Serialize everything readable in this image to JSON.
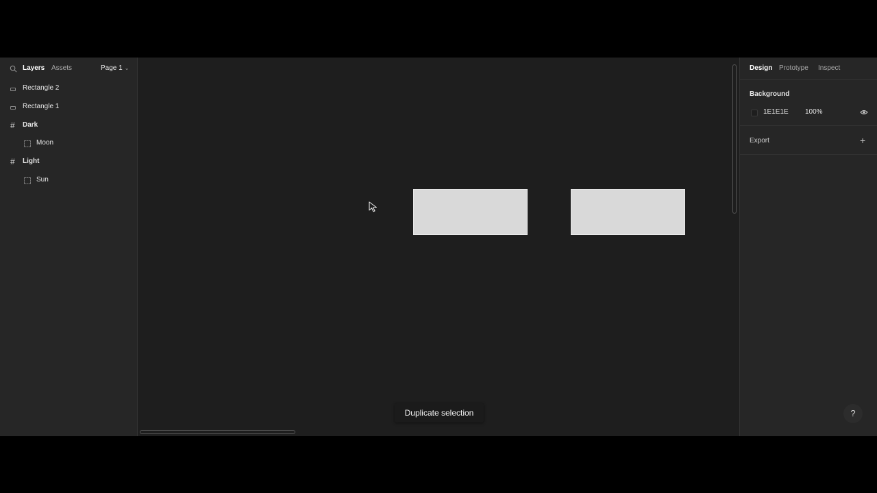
{
  "left_panel": {
    "tabs": {
      "layers": "Layers",
      "assets": "Assets"
    },
    "page_select": "Page 1",
    "layers": [
      {
        "label": "Rectangle 2",
        "icon": "rectangle-icon"
      },
      {
        "label": "Rectangle 1",
        "icon": "rectangle-icon"
      },
      {
        "label": "Dark",
        "icon": "frame-icon"
      },
      {
        "label": "Moon",
        "icon": "group-icon"
      },
      {
        "label": "Light",
        "icon": "frame-icon"
      },
      {
        "label": "Sun",
        "icon": "group-icon"
      }
    ]
  },
  "canvas": {
    "toast": "Duplicate selection",
    "rect_color": "#D9D9D9",
    "background_color": "#1E1E1E"
  },
  "right_panel": {
    "tabs": {
      "design": "Design",
      "prototype": "Prototype",
      "inspect": "Inspect"
    },
    "background": {
      "title": "Background",
      "hex": "1E1E1E",
      "opacity": "100%"
    },
    "export": {
      "title": "Export"
    },
    "help": "?"
  }
}
